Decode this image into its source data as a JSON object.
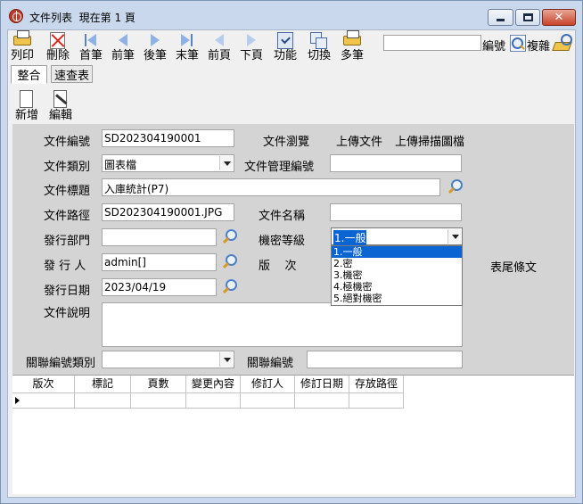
{
  "window": {
    "title": "文件列表  現在第 1 頁"
  },
  "toolbar": {
    "items": [
      {
        "label": "列印",
        "icon": "print-icon"
      },
      {
        "label": "刪除",
        "icon": "delete-icon"
      },
      {
        "label": "首筆",
        "icon": "first-record-icon"
      },
      {
        "label": "前筆",
        "icon": "prev-record-icon"
      },
      {
        "label": "後筆",
        "icon": "next-record-icon"
      },
      {
        "label": "末筆",
        "icon": "last-record-icon"
      },
      {
        "label": "前頁",
        "icon": "prev-page-icon"
      },
      {
        "label": "下頁",
        "icon": "next-page-icon"
      },
      {
        "label": "功能",
        "icon": "function-icon"
      },
      {
        "label": "切換",
        "icon": "switch-icon"
      },
      {
        "label": "多筆",
        "icon": "multi-record-icon"
      }
    ],
    "search_value": "",
    "search_label": "編號",
    "copy_label": "複雜"
  },
  "tabs": [
    {
      "label": "整合",
      "active": true
    },
    {
      "label": "速查表",
      "active": false
    }
  ],
  "sub_toolbar": {
    "add_label": "新增",
    "edit_label": "編輯"
  },
  "form": {
    "doc_no_label": "文件編號",
    "doc_no_value": "SD202304190001",
    "browse_label": "文件瀏覽",
    "upload_label": "上傳文件",
    "upload_scan_label": "上傳掃描圖檔",
    "category_label": "文件類別",
    "category_value": "圖表檔",
    "mgmt_no_label": "文件管理編號",
    "mgmt_no_value": "",
    "title_label": "文件標題",
    "title_value": "入庫統計(P7)",
    "path_label": "文件路徑",
    "path_value": "SD202304190001.JPG",
    "filename_label": "文件名稱",
    "filename_value": "",
    "dept_label": "發行部門",
    "dept_value": "",
    "security_label": "機密等級",
    "security_value": "1.一般",
    "issuer_label": "發 行 人",
    "issuer_value": "admin[]",
    "version_label": "版    次",
    "footer_label": "表尾條文",
    "date_label": "發行日期",
    "date_value": "2023/04/19",
    "desc_label": "文件說明",
    "desc_value": "",
    "rel_type_label": "關聯編號類別",
    "rel_type_value": "",
    "rel_no_label": "關聯編號",
    "rel_no_value": ""
  },
  "security_options": [
    "1.一般",
    "2.密",
    "3.機密",
    "4.極機密",
    "5.絕對機密"
  ],
  "grid": {
    "columns": [
      "版次",
      "標記",
      "頁數",
      "變更內容",
      "修訂人",
      "修訂日期",
      "存放路徑"
    ]
  },
  "colors": {
    "selection": "#0a64d2",
    "panel": "#d4d4d4",
    "titlebar": "#c9d8ec"
  }
}
